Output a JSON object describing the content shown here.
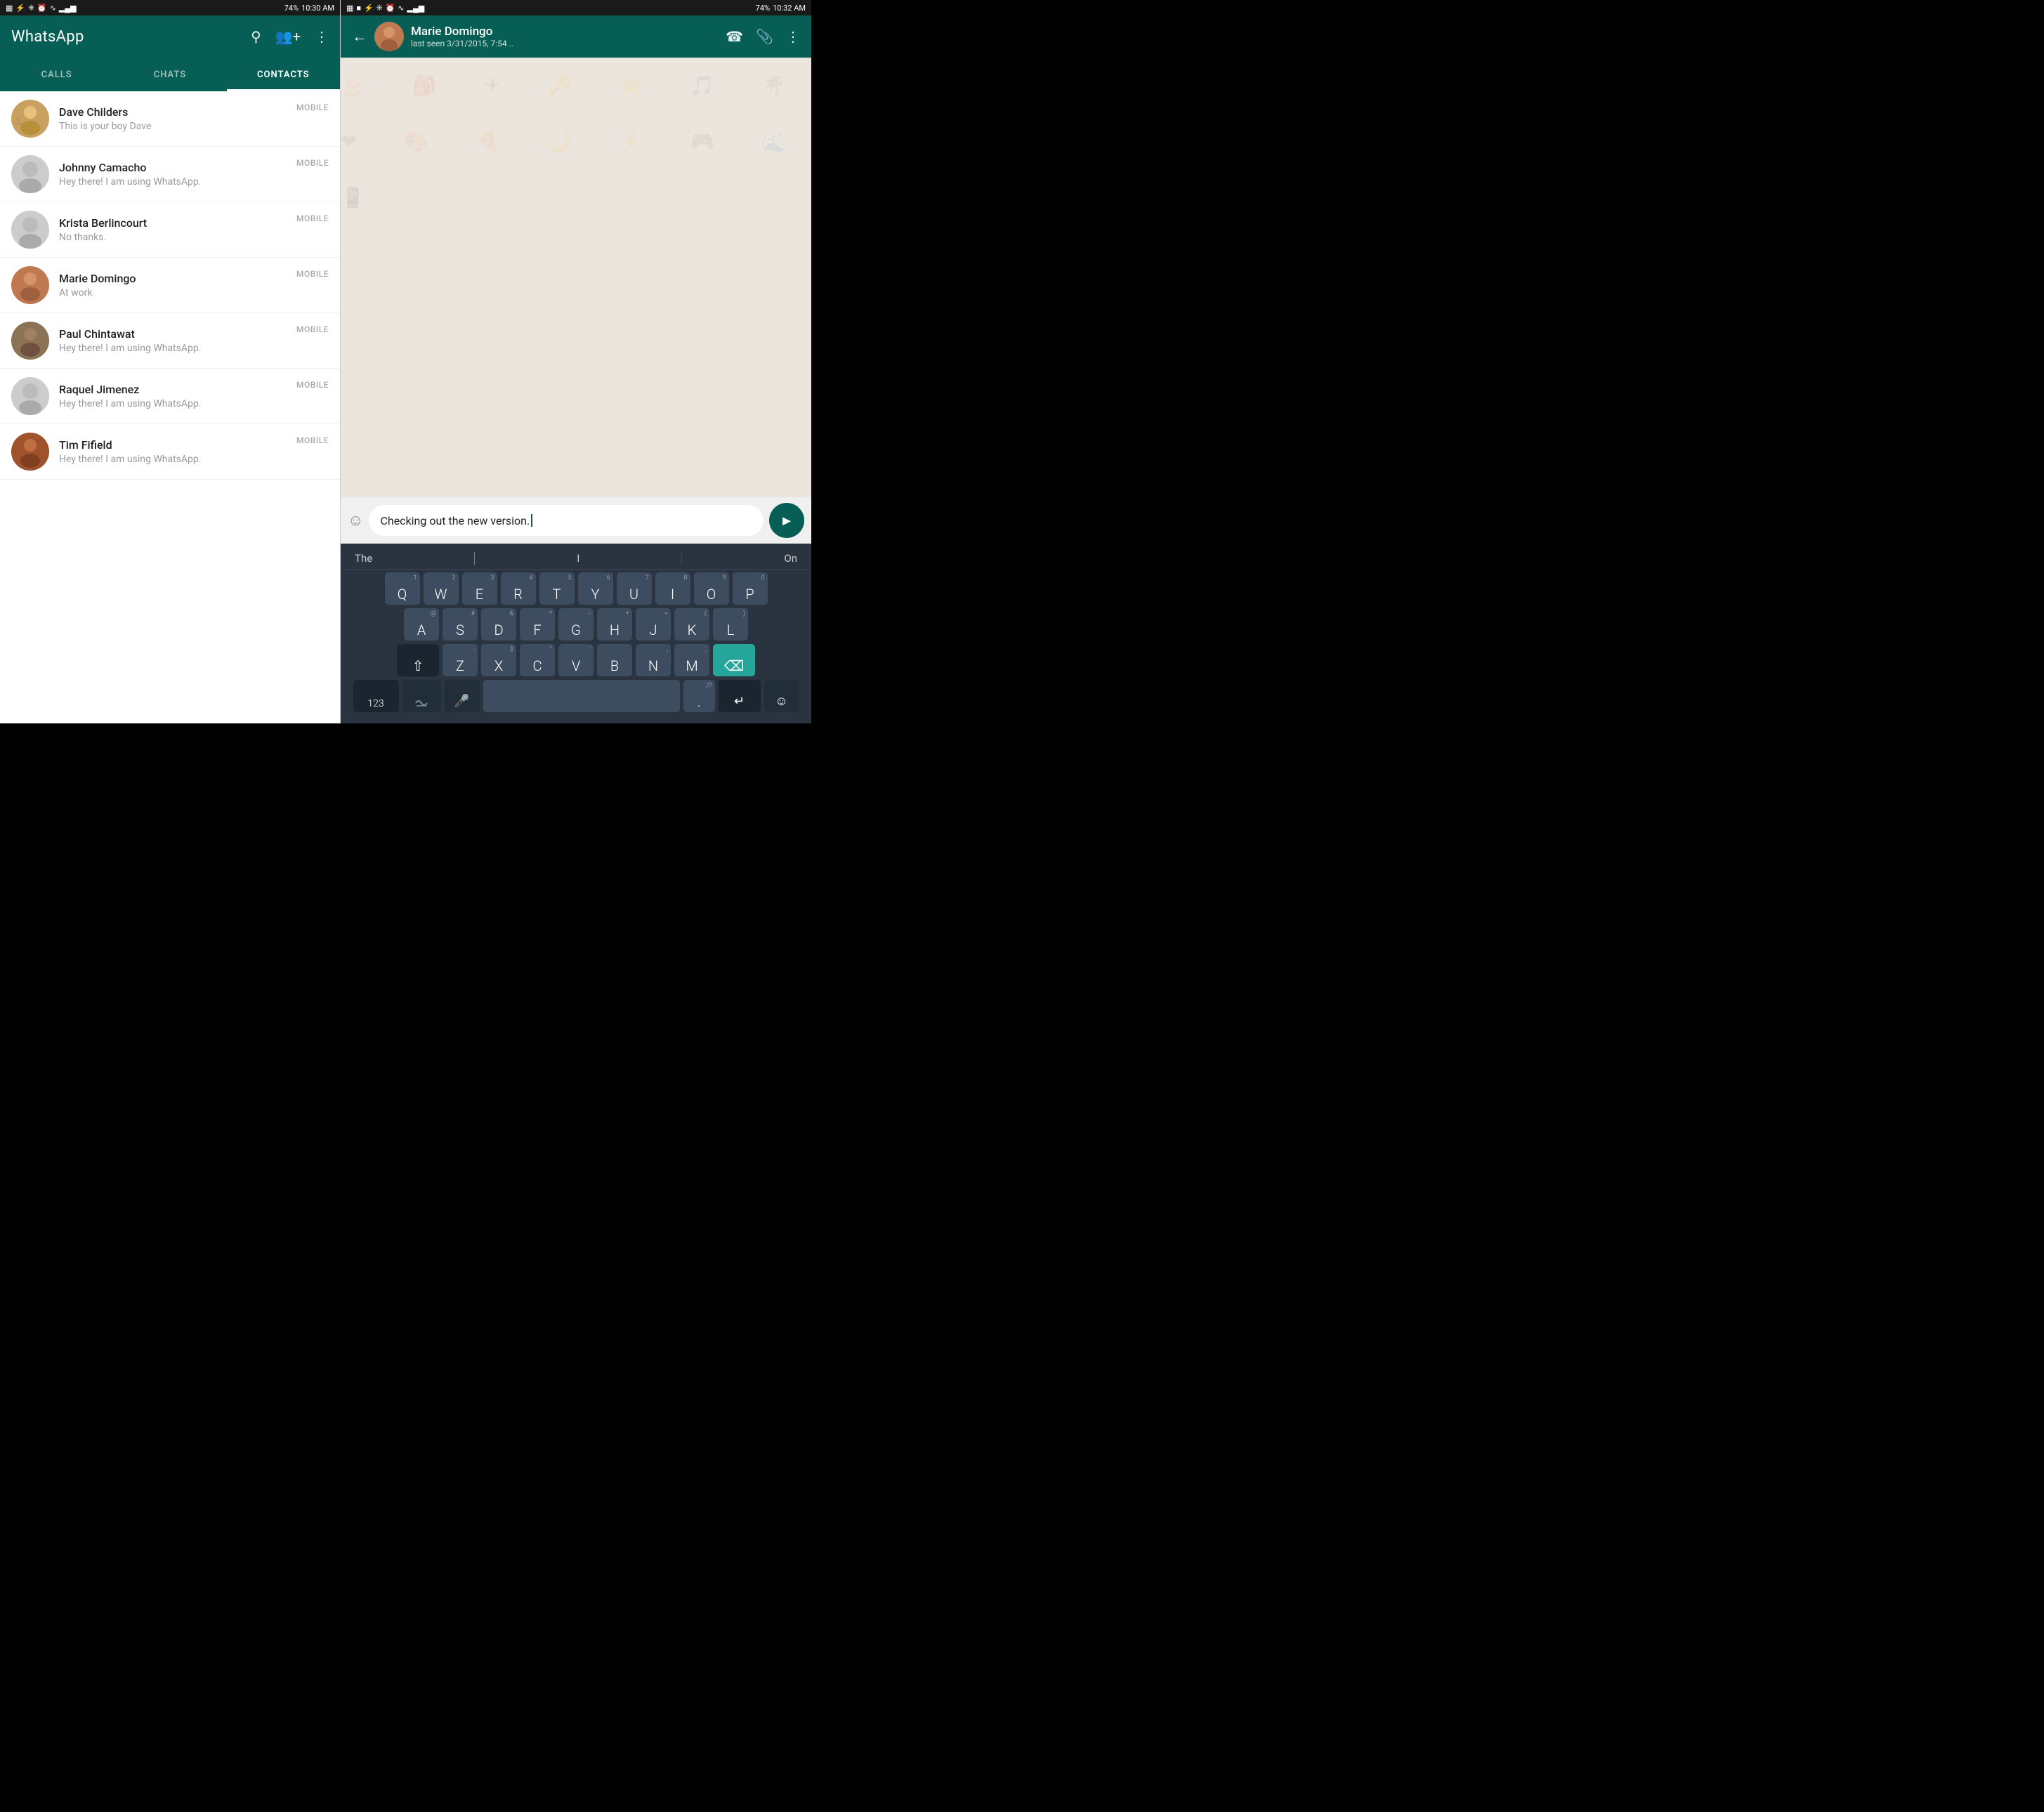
{
  "left": {
    "statusBar": {
      "time": "10:30 AM",
      "battery": "74%",
      "signal": "4G"
    },
    "appTitle": "WhatsApp",
    "tabs": [
      {
        "id": "calls",
        "label": "CALLS",
        "active": false
      },
      {
        "id": "chats",
        "label": "CHATS",
        "active": false
      },
      {
        "id": "contacts",
        "label": "CONTACTS",
        "active": true
      }
    ],
    "contacts": [
      {
        "name": "Dave Childers",
        "status": "This is your boy Dave",
        "type": "MOBILE",
        "avatarType": "dave"
      },
      {
        "name": "Johnny Camacho",
        "status": "Hey there! I am using WhatsApp.",
        "type": "MOBILE",
        "avatarType": "generic"
      },
      {
        "name": "Krista Berlincourt",
        "status": "No thanks.",
        "type": "MOBILE",
        "avatarType": "generic"
      },
      {
        "name": "Marie Domingo",
        "status": "At work",
        "type": "MOBILE",
        "avatarType": "marie"
      },
      {
        "name": "Paul Chintawat",
        "status": "Hey there! I am using WhatsApp.",
        "type": "MOBILE",
        "avatarType": "paul"
      },
      {
        "name": "Raquel Jimenez",
        "status": "Hey there! I am using WhatsApp.",
        "type": "MOBILE",
        "avatarType": "generic"
      },
      {
        "name": "Tim Fifield",
        "status": "Hey there! I am using WhatsApp.",
        "type": "MOBILE",
        "avatarType": "tim"
      }
    ]
  },
  "right": {
    "statusBar": {
      "time": "10:32 AM",
      "battery": "74%"
    },
    "chatName": "Marie Domingo",
    "chatLastSeen": "last seen 3/31/2015, 7:54 ..",
    "messageText": "Checking out the new version.",
    "keyboard": {
      "suggestions": [
        "The",
        "I",
        "On"
      ],
      "rows": [
        {
          "keys": [
            {
              "primary": "Q",
              "secondary": "1"
            },
            {
              "primary": "W",
              "secondary": "2"
            },
            {
              "primary": "E",
              "secondary": "3"
            },
            {
              "primary": "R",
              "secondary": "4"
            },
            {
              "primary": "T",
              "secondary": "5"
            },
            {
              "primary": "Y",
              "secondary": "6"
            },
            {
              "primary": "U",
              "secondary": "7"
            },
            {
              "primary": "I",
              "secondary": "8"
            },
            {
              "primary": "O",
              "secondary": "9"
            },
            {
              "primary": "P",
              "secondary": "0"
            }
          ]
        },
        {
          "keys": [
            {
              "primary": "A",
              "secondary": "@"
            },
            {
              "primary": "S",
              "secondary": "#"
            },
            {
              "primary": "D",
              "secondary": "&"
            },
            {
              "primary": "F",
              "secondary": "*"
            },
            {
              "primary": "G",
              "secondary": "-"
            },
            {
              "primary": "H",
              "secondary": "+"
            },
            {
              "primary": "J",
              "secondary": "="
            },
            {
              "primary": "K",
              "secondary": "("
            },
            {
              "primary": "L",
              "secondary": ")"
            }
          ]
        },
        {
          "keys": [
            {
              "primary": "⇧",
              "secondary": "",
              "special": true
            },
            {
              "primary": "Z",
              "secondary": "-"
            },
            {
              "primary": "X",
              "secondary": "$"
            },
            {
              "primary": "C",
              "secondary": "\""
            },
            {
              "primary": "V",
              "secondary": "'"
            },
            {
              "primary": "B",
              "secondary": ""
            },
            {
              "primary": "N",
              "secondary": ","
            },
            {
              "primary": "M",
              "secondary": ";"
            },
            {
              "primary": "⌫",
              "secondary": "",
              "special": true
            }
          ]
        }
      ],
      "bottomRow": [
        {
          "primary": "123",
          "special": true
        },
        {
          "primary": ",",
          "secondary": ""
        },
        {
          "primary": "",
          "isSpace": true
        },
        {
          "primary": ".",
          "secondary": ""
        },
        {
          "primary": "↵",
          "special": true
        }
      ]
    }
  }
}
